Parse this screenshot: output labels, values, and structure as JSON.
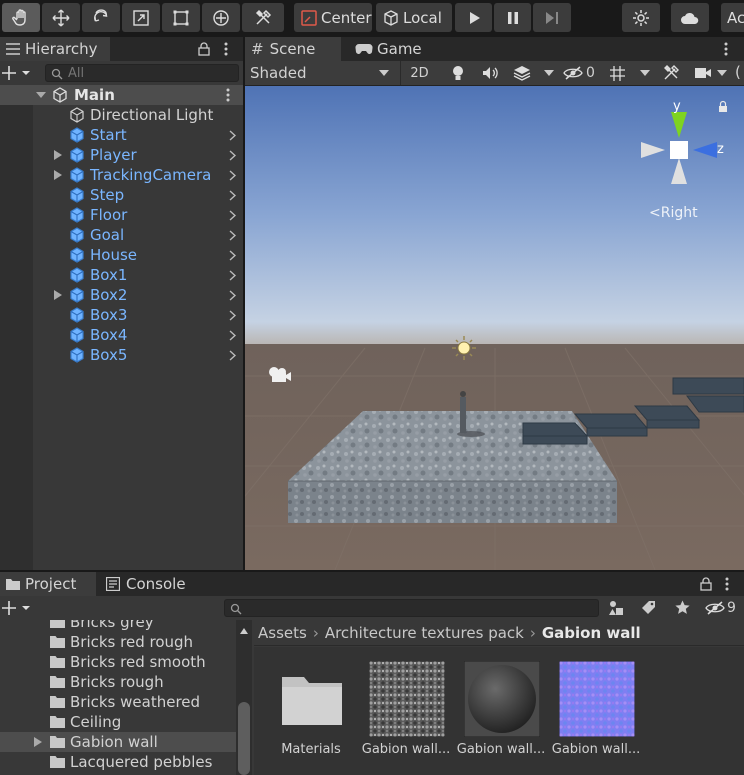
{
  "toolbar": {
    "pivot_label": "Center",
    "space_label": "Local",
    "account_label": "Ac"
  },
  "hierarchy": {
    "tab_label": "Hierarchy",
    "search_placeholder": "All",
    "scene_name": "Main",
    "items": [
      {
        "label": "Directional Light",
        "prefab": false,
        "expandable": false,
        "has_arrow": false
      },
      {
        "label": "Start",
        "prefab": true,
        "expandable": false,
        "has_arrow": true
      },
      {
        "label": "Player",
        "prefab": true,
        "expandable": true,
        "has_arrow": true
      },
      {
        "label": "TrackingCamera",
        "prefab": true,
        "expandable": true,
        "has_arrow": true
      },
      {
        "label": "Step",
        "prefab": true,
        "expandable": false,
        "has_arrow": true
      },
      {
        "label": "Floor",
        "prefab": true,
        "expandable": false,
        "has_arrow": true
      },
      {
        "label": "Goal",
        "prefab": true,
        "expandable": false,
        "has_arrow": true
      },
      {
        "label": "House",
        "prefab": true,
        "expandable": false,
        "has_arrow": true
      },
      {
        "label": "Box1",
        "prefab": true,
        "expandable": false,
        "has_arrow": true
      },
      {
        "label": "Box2",
        "prefab": true,
        "expandable": true,
        "has_arrow": true
      },
      {
        "label": "Box3",
        "prefab": true,
        "expandable": false,
        "has_arrow": true
      },
      {
        "label": "Box4",
        "prefab": true,
        "expandable": false,
        "has_arrow": true
      },
      {
        "label": "Box5",
        "prefab": true,
        "expandable": false,
        "has_arrow": true
      }
    ]
  },
  "scene": {
    "tabs": [
      "Scene",
      "Game"
    ],
    "shading_mode": "Shaded",
    "mode_2d": "2D",
    "hidden_count": "0",
    "gizmo_y": "y",
    "gizmo_z": "z",
    "view_label": "Right"
  },
  "project": {
    "tabs": [
      "Project",
      "Console"
    ],
    "hidden_count": "9",
    "folders": [
      {
        "label": "Bricks grey",
        "selected": false
      },
      {
        "label": "Bricks red rough",
        "selected": false
      },
      {
        "label": "Bricks red smooth",
        "selected": false
      },
      {
        "label": "Bricks rough",
        "selected": false
      },
      {
        "label": "Bricks weathered",
        "selected": false
      },
      {
        "label": "Ceiling",
        "selected": false
      },
      {
        "label": "Gabion wall",
        "selected": true
      },
      {
        "label": "Lacquered pebbles",
        "selected": false
      }
    ],
    "breadcrumb": [
      "Assets",
      "Architecture textures pack",
      "Gabion wall"
    ],
    "assets": [
      {
        "label": "Materials",
        "kind": "folder"
      },
      {
        "label": "Gabion wall...",
        "kind": "texture"
      },
      {
        "label": "Gabion wall...",
        "kind": "material"
      },
      {
        "label": "Gabion wall...",
        "kind": "normal"
      }
    ]
  },
  "colors": {
    "accent_blue": "#7ab6ff",
    "selection": "#4d4d4d",
    "panel": "#383838"
  }
}
